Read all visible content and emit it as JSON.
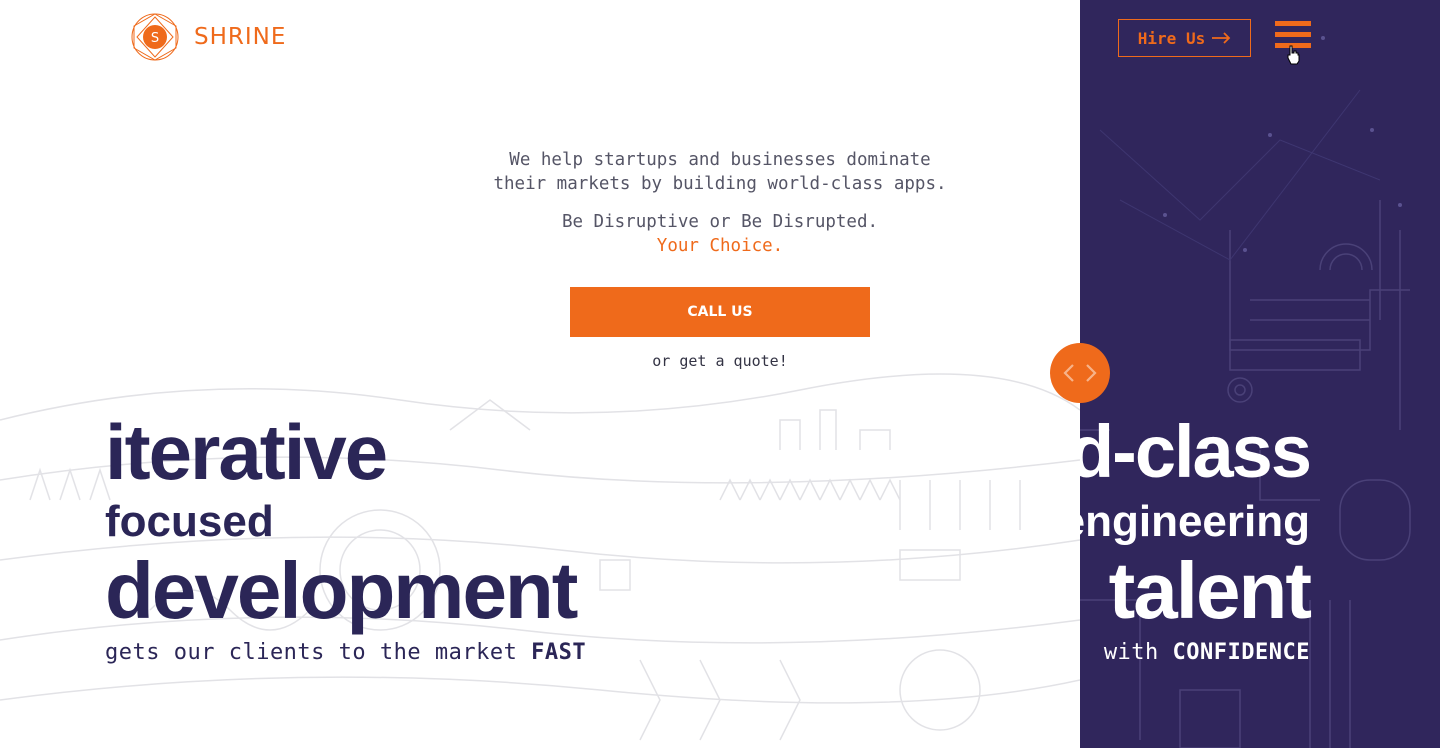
{
  "brand": {
    "logo_letter": "S",
    "name": "SHRINE",
    "accent_color": "#ef6a1b",
    "dark_color": "#30265c"
  },
  "header": {
    "hire_label": "Hire Us",
    "hire_icon": "arrow-right-icon",
    "menu_icon": "hamburger-menu-icon"
  },
  "hero": {
    "line1": "We help startups and businesses dominate",
    "line2": "their markets by building world-class apps.",
    "line3": "Be Disruptive or Be Disrupted.",
    "line4": "Your Choice.",
    "cta_label": "CALL US",
    "quote_label": "or get a quote!"
  },
  "comparison_left": {
    "word1": "iterative",
    "word2": "focused",
    "word3": "development",
    "tagline_prefix": "gets our clients to the market ",
    "tagline_bold": "FAST"
  },
  "comparison_right": {
    "word1": "d-class",
    "word2": "engineering",
    "word3": "talent",
    "tagline_prefix": "with ",
    "tagline_bold": "CONFIDENCE"
  },
  "slider": {
    "left_icon": "chevron-left-icon",
    "right_icon": "chevron-right-icon"
  }
}
